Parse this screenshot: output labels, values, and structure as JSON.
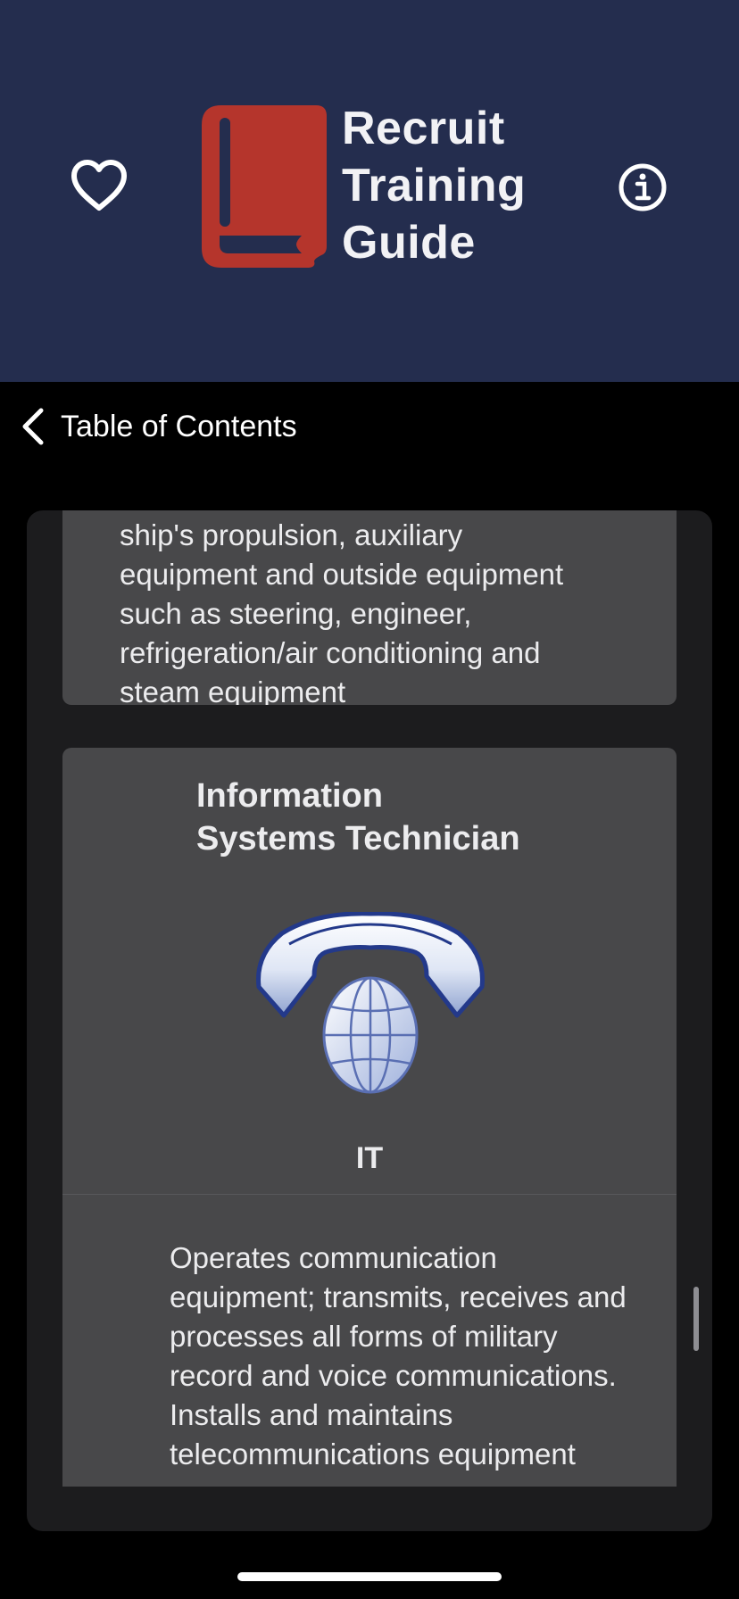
{
  "header": {
    "app_title_lines": [
      "Recruit",
      "Training",
      "Guide"
    ],
    "favorite_icon": "heart-outline-icon",
    "info_icon": "info-circle-icon",
    "logo_icon": "book-icon",
    "colors": {
      "header_background": "#242d4e",
      "logo_red": "#b5352c",
      "title_text": "#f2f2f5"
    }
  },
  "nav": {
    "back_icon": "chevron-left-icon",
    "back_label": "Table of Contents"
  },
  "content": {
    "previous_card": {
      "description_lines": [
        "ship's propulsion, auxiliary",
        "equipment and outside equipment",
        "such as steering, engineer,",
        "refrigeration/air conditioning and",
        "steam equipment"
      ]
    },
    "rating_card": {
      "title_lines": [
        "Information",
        "Systems Technician"
      ],
      "emblem_icon": "telephone-globe-icon",
      "abbreviation": "IT",
      "description_lines": [
        "Operates communication",
        "equipment; transmits, receives and",
        "processes all forms of military",
        "record and voice communications.",
        "Installs and maintains",
        "telecommunications equipment"
      ]
    },
    "colors": {
      "card_background": "#48484a",
      "outer_background": "#1c1c1e",
      "text": "#ececee"
    }
  }
}
